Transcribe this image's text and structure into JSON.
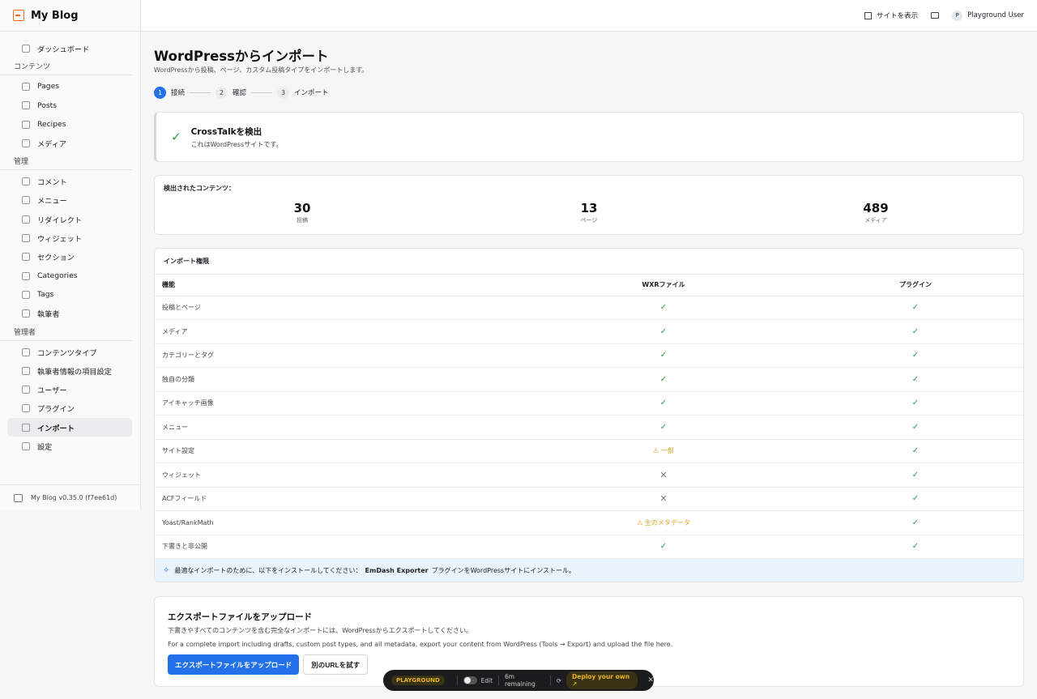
{
  "brand": {
    "name": "My Blog"
  },
  "topbar": {
    "view_site": "サイトを表示",
    "user_initial": "P",
    "user_name": "Playground User"
  },
  "sidebar": {
    "dashboard": "ダッシュボード",
    "section_content": "コンテンツ",
    "content_items": [
      "Pages",
      "Posts",
      "Recipes",
      "メディア"
    ],
    "section_manage": "管理",
    "manage_items": [
      "コメント",
      "メニュー",
      "リダイレクト",
      "ウィジェット",
      "セクション",
      "Categories",
      "Tags",
      "執筆者"
    ],
    "section_admin": "管理者",
    "admin_items": [
      "コンテンツタイプ",
      "執筆者情報の項目設定",
      "ユーザー",
      "プラグイン",
      "インポート",
      "設定"
    ],
    "footer": "My Blog v0.35.0 (f7ee61d)"
  },
  "page": {
    "title": "WordPressからインポート",
    "subtitle": "WordPressから投稿、ページ、カスタム投稿タイプをインポートします。",
    "steps": [
      {
        "num": "1",
        "label": "接続"
      },
      {
        "num": "2",
        "label": "確認"
      },
      {
        "num": "3",
        "label": "インポート"
      }
    ]
  },
  "detect": {
    "title": "CrossTalkを検出",
    "sub": "これはWordPressサイトです。"
  },
  "stats": {
    "label": "検出されたコンテンツ：",
    "items": [
      {
        "value": "30",
        "label": "投稿"
      },
      {
        "value": "13",
        "label": "ページ"
      },
      {
        "value": "489",
        "label": "メディア"
      }
    ]
  },
  "permissions": {
    "title": "インポート権限",
    "headers": [
      "機能",
      "WXRファイル",
      "プラグイン"
    ],
    "rows": [
      {
        "feature": "投稿とページ",
        "wxr": "✓",
        "plugin": "✓"
      },
      {
        "feature": "メディア",
        "wxr": "✓",
        "plugin": "✓"
      },
      {
        "feature": "カテゴリーとタグ",
        "wxr": "✓",
        "plugin": "✓"
      },
      {
        "feature": "独自の分類",
        "wxr": "✓",
        "plugin": "✓"
      },
      {
        "feature": "アイキャッチ画像",
        "wxr": "✓",
        "plugin": "✓"
      },
      {
        "feature": "メニュー",
        "wxr": "✓",
        "plugin": "✓"
      },
      {
        "feature": "サイト設定",
        "wxr": "⚠ 一部",
        "plugin": "✓"
      },
      {
        "feature": "ウィジェット",
        "wxr": "✕",
        "plugin": "✓"
      },
      {
        "feature": "ACFフィールド",
        "wxr": "✕",
        "plugin": "✓"
      },
      {
        "feature": "Yoast/RankMath",
        "wxr": "⚠ 生のメタデータ",
        "plugin": "✓"
      },
      {
        "feature": "下書きと非公開",
        "wxr": "✓",
        "plugin": "✓"
      }
    ],
    "tip_prefix": "最適なインポートのために、以下をインストールしてください：",
    "tip_bold": "EmDash Exporter",
    "tip_suffix": "プラグインをWordPressサイトにインストール。"
  },
  "upload": {
    "title": "エクスポートファイルをアップロード",
    "sub": "下書きやすべてのコンテンツを含む完全なインポートには、WordPressからエクスポートしてください。",
    "en": "For a complete import including drafts, custom post types, and all metadata, export your content from WordPress (Tools → Export) and upload the file here.",
    "primary_btn": "エクスポートファイルをアップロード",
    "secondary_btn": "別のURLを試す"
  },
  "playground": {
    "tag": "PLAYGROUND",
    "edit": "Edit",
    "remaining": "6m remaining",
    "deploy": "Deploy your own ↗",
    "close": "✕"
  }
}
